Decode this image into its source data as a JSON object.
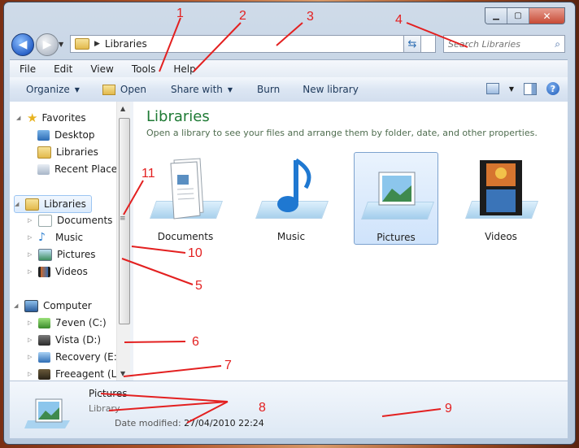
{
  "window": {
    "close_glyph": "✕",
    "minimize_glyph": "▁",
    "maximize_glyph": "▢"
  },
  "address": {
    "crumb": "Libraries"
  },
  "search": {
    "placeholder": "Search Libraries"
  },
  "menu": [
    "File",
    "Edit",
    "View",
    "Tools",
    "Help"
  ],
  "toolbar": {
    "organize": "Organize",
    "open": "Open",
    "share_with": "Share with",
    "burn": "Burn",
    "new_library": "New library"
  },
  "nav": {
    "favorites": {
      "label": "Favorites",
      "items": [
        "Desktop",
        "Libraries",
        "Recent Places"
      ]
    },
    "libraries": {
      "label": "Libraries",
      "items": [
        "Documents",
        "Music",
        "Pictures",
        "Videos"
      ]
    },
    "computer": {
      "label": "Computer",
      "items": [
        "7even (C:)",
        "Vista (D:)",
        "Recovery (E:)",
        "Freeagent (L:)"
      ]
    }
  },
  "main": {
    "title": "Libraries",
    "subtitle": "Open a library to see your files and arrange them by folder, date, and other properties.",
    "tiles": [
      "Documents",
      "Music",
      "Pictures",
      "Videos"
    ]
  },
  "details": {
    "name": "Pictures",
    "type": "Library",
    "date_label": "Date modified:",
    "date_value": "27/04/2010 22:24"
  },
  "annotations": [
    "1",
    "2",
    "3",
    "4",
    "5",
    "6",
    "7",
    "8",
    "9",
    "10",
    "11"
  ],
  "colors": {
    "annotation": "#e32020",
    "library_title": "#1e7a34"
  }
}
